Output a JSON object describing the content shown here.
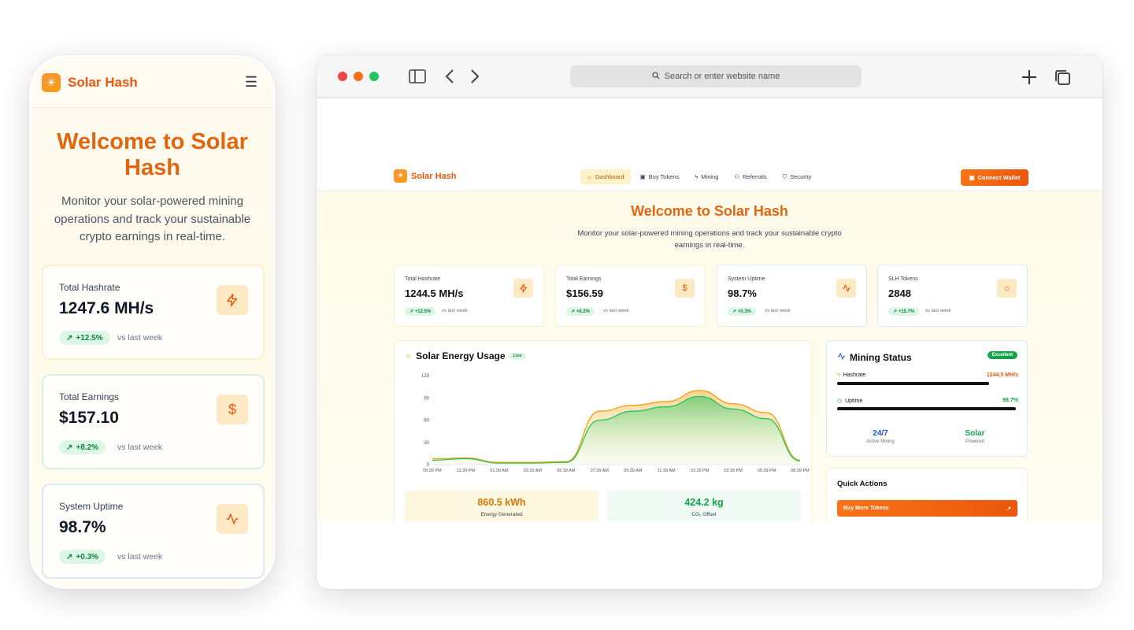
{
  "phone": {
    "logo_text": "Solar Hash",
    "title": "Welcome to Solar Hash",
    "subtitle": "Monitor your solar-powered mining operations and track your sustainable crypto earnings in real-time.",
    "cards": [
      {
        "label": "Total Hashrate",
        "value": "1247.6 MH/s",
        "change": "+12.5%",
        "vs": "vs last week",
        "icon": "lightning-icon"
      },
      {
        "label": "Total Earnings",
        "value": "$157.10",
        "change": "+8.2%",
        "vs": "vs last week",
        "icon": "dollar-icon"
      },
      {
        "label": "System Uptime",
        "value": "98.7%",
        "change": "+0.3%",
        "vs": "vs last week",
        "icon": "activity-icon"
      }
    ]
  },
  "browser": {
    "url_placeholder": "Search or enter website name",
    "site": {
      "logo_text": "Solar Hash",
      "nav": [
        {
          "label": "Dashboard",
          "icon": "sun-icon",
          "active": true
        },
        {
          "label": "Buy Tokens",
          "icon": "wallet-icon"
        },
        {
          "label": "Mining",
          "icon": "lightning-icon"
        },
        {
          "label": "Referrals",
          "icon": "users-icon"
        },
        {
          "label": "Security",
          "icon": "shield-icon"
        }
      ],
      "connect_label": "Connect Wallet",
      "title": "Welcome to Solar Hash",
      "subtitle": "Monitor your solar-powered mining operations and track your sustainable crypto earnings in real-time.",
      "stats": [
        {
          "label": "Total Hashrate",
          "value": "1244.5 MH/s",
          "change": "+12.5%",
          "vs": "vs last week",
          "icon": "lightning-icon"
        },
        {
          "label": "Total Earnings",
          "value": "$156.59",
          "change": "+8.2%",
          "vs": "vs last week",
          "icon": "dollar-icon"
        },
        {
          "label": "System Uptime",
          "value": "98.7%",
          "change": "+0.3%",
          "vs": "vs last week",
          "icon": "activity-icon"
        },
        {
          "label": "SLH Tokens",
          "value": "2848",
          "change": "+15.7%",
          "vs": "vs last week",
          "icon": "sun-icon"
        }
      ],
      "energy": {
        "title": "Solar Energy Usage",
        "badge": "Live",
        "generated_value": "860.5 kWh",
        "generated_label": "Energy Generated",
        "offset_value": "424.2 kg",
        "offset_label": "CO₂ Offset"
      },
      "mining": {
        "title": "Mining Status",
        "badge": "Excellent",
        "hashrate_label": "Hashrate",
        "hashrate_value": "1244.5 MH/s",
        "hashrate_fraction": 0.84,
        "uptime_label": "Uptime",
        "uptime_value": "98.7%",
        "uptime_fraction": 0.987,
        "stat1_value": "24/7",
        "stat1_label": "Active Mining",
        "stat2_value": "Solar",
        "stat2_label": "Powered"
      },
      "quick": {
        "title": "Quick Actions",
        "buy_label": "Buy More Tokens"
      }
    }
  },
  "chart_data": {
    "type": "area",
    "title": "Solar Energy Usage",
    "x": [
      "09:39 PM",
      "11:39 PM",
      "01:39 AM",
      "03:39 AM",
      "05:39 AM",
      "07:39 AM",
      "09:39 AM",
      "11:39 AM",
      "01:39 PM",
      "03:39 PM",
      "05:39 PM",
      "08:39 PM"
    ],
    "ylim": [
      0,
      120
    ],
    "yticks": [
      0,
      30,
      60,
      90,
      120
    ],
    "series": [
      {
        "values": [
          8,
          9,
          3,
          3,
          4,
          72,
          80,
          85,
          100,
          82,
          70,
          6
        ],
        "color": "#f59e0b"
      },
      {
        "values": [
          6,
          8,
          2,
          2,
          3,
          60,
          72,
          78,
          92,
          75,
          62,
          5
        ],
        "color": "#22c55e"
      }
    ]
  }
}
